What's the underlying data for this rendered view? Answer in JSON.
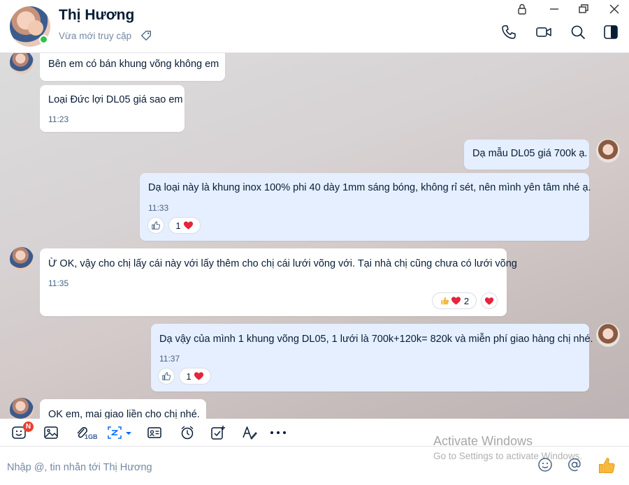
{
  "header": {
    "contact_name": "Thị Hương",
    "status": "Vừa mới truy cập"
  },
  "messages": [
    {
      "text": "Bên em có bán khung võng không em",
      "time": "",
      "side": "in"
    },
    {
      "text": "Loại Đức lợi DL05 giá sao em",
      "time": "11:23",
      "side": "in"
    },
    {
      "text": "Dạ mẫu DL05 giá 700k ạ.",
      "time": "",
      "side": "out"
    },
    {
      "text": "Dạ loại này là khung inox 100% phi 40 dày 1mm sáng bóng, không rỉ sét, nên mình yên tâm nhé ạ.",
      "time": "11:33",
      "side": "out",
      "reaction_count": "1"
    },
    {
      "text": "Ừ OK, vậy cho chị lấy cái này với lấy thêm cho chị cái lưới võng với. Tại nhà chị cũng chưa có lưới võng",
      "time": "11:35",
      "side": "in",
      "reaction_count": "2"
    },
    {
      "text": "Dạ vậy của mình 1 khung võng DL05, 1 lưới là 700k+120k= 820k và miễn phí giao hàng chị nhé.",
      "time": "11:37",
      "side": "out",
      "reaction_count": "1"
    },
    {
      "text": "OK em, mai giao liền cho chị nhé.",
      "time": "",
      "side": "in"
    }
  ],
  "toolbar": {
    "badge": "N",
    "file_limit": "1GB"
  },
  "input": {
    "placeholder": "Nhập @, tin nhắn tới Thị Hương"
  },
  "watermark": {
    "title": "Activate Windows",
    "subtitle": "Go to Settings to activate Windows."
  },
  "colors": {
    "accent": "#0068ff",
    "outgoing_bubble": "#e5efff",
    "online": "#31c24d",
    "heart": "#e8233c",
    "like": "#f6b93b"
  }
}
